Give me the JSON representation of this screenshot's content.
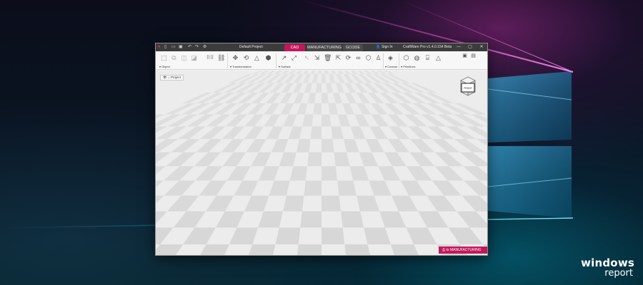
{
  "app": {
    "project_title": "Default Project",
    "sign_in": "Sign In",
    "version": "CraftWare Pro v1.4.0.154 Beta",
    "tabs": [
      {
        "label": "CAD",
        "active": true
      },
      {
        "label": "MANUFACTURING",
        "active": false
      },
      {
        "label": "GCODE",
        "active": false
      }
    ],
    "accent_color": "#c2185b"
  },
  "ribbon": {
    "groups": [
      {
        "label": "Object"
      },
      {
        "label": "Transformation"
      },
      {
        "label": "Surface"
      },
      {
        "label": "Contour"
      },
      {
        "label": "Primitives"
      }
    ]
  },
  "viewport": {
    "project_button": "Project",
    "viewcube_label": "FRONT",
    "to_manufacturing": "to MANUFACTURING"
  },
  "desktop": {
    "brand_line1": "windows",
    "brand_line2": "report"
  }
}
